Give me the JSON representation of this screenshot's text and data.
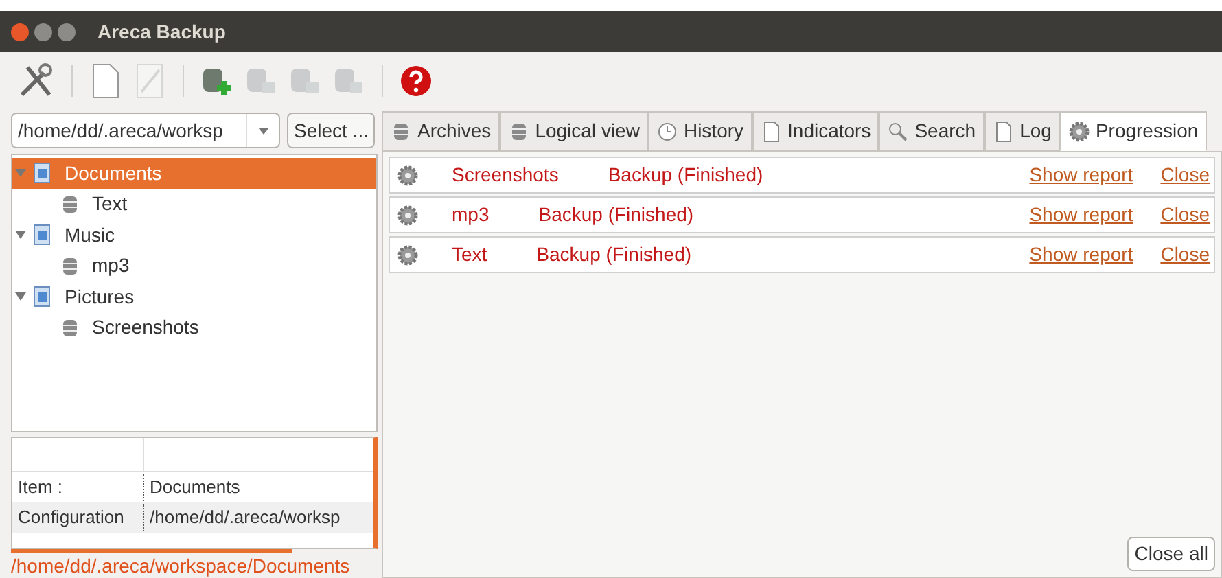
{
  "window": {
    "title": "Areca Backup"
  },
  "toolbar": [
    {
      "kind": "tools",
      "disabled": false
    },
    {
      "kind": "separator"
    },
    {
      "kind": "new",
      "disabled": false
    },
    {
      "kind": "edit",
      "disabled": true
    },
    {
      "kind": "separator"
    },
    {
      "kind": "db-add",
      "disabled": false
    },
    {
      "kind": "db",
      "disabled": true
    },
    {
      "kind": "db",
      "disabled": true
    },
    {
      "kind": "db",
      "disabled": true
    },
    {
      "kind": "separator"
    },
    {
      "kind": "help",
      "disabled": false
    }
  ],
  "workspace": {
    "value": "/home/dd/.areca/worksp",
    "button": "Select ..."
  },
  "tree": [
    {
      "label": "Documents",
      "kind": "folder",
      "expanded": true,
      "selected": true,
      "children": [
        {
          "label": "Text",
          "kind": "target",
          "selected": false
        }
      ]
    },
    {
      "label": "Music",
      "kind": "folder",
      "expanded": true,
      "selected": false,
      "children": [
        {
          "label": "mp3",
          "kind": "target",
          "selected": false
        }
      ]
    },
    {
      "label": "Pictures",
      "kind": "folder",
      "expanded": true,
      "selected": false,
      "children": [
        {
          "label": "Screenshots",
          "kind": "target",
          "selected": false
        }
      ]
    }
  ],
  "properties": [
    {
      "key": "Item :",
      "value": "Documents"
    },
    {
      "key": "Configuration",
      "value": "/home/dd/.areca/worksp"
    }
  ],
  "status_bar": "/home/dd/.areca/workspace/Documents",
  "tabs": [
    {
      "label": "Archives",
      "kind": "db",
      "selected": false
    },
    {
      "label": "Logical view",
      "kind": "db",
      "selected": false
    },
    {
      "label": "History",
      "kind": "clock",
      "selected": false
    },
    {
      "label": "Indicators",
      "kind": "page",
      "selected": false
    },
    {
      "label": "Search",
      "kind": "search",
      "selected": false
    },
    {
      "label": "Log",
      "kind": "page",
      "selected": false
    },
    {
      "label": "Progression",
      "kind": "gear",
      "selected": true
    }
  ],
  "tasks": [
    {
      "name": "Screenshots",
      "status": "Backup (Finished)",
      "report": "Show report",
      "close": "Close"
    },
    {
      "name": "mp3",
      "status": "Backup (Finished)",
      "report": "Show report",
      "close": "Close"
    },
    {
      "name": "Text",
      "status": "Backup (Finished)",
      "report": "Show report",
      "close": "Close"
    }
  ],
  "close_all": "Close all"
}
